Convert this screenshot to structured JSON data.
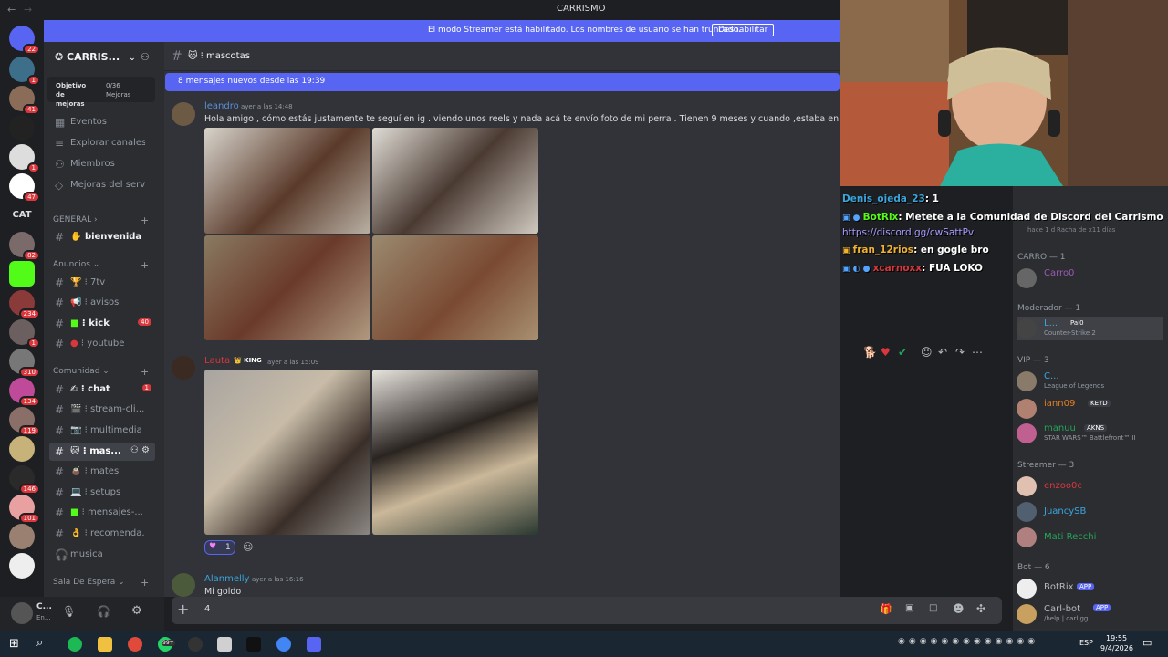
{
  "window": {
    "title": "CARRISMO",
    "back": "←",
    "forward": "→"
  },
  "banner": {
    "text": "El modo Streamer está habilitado. Los nombres de usuario se han truncado.",
    "button": "Deshabilitar"
  },
  "servers": {
    "badges": [
      "22",
      "1",
      "41",
      "1",
      "47",
      "82",
      "234",
      "1",
      "310",
      "134",
      "119",
      "146",
      "101"
    ],
    "cat_label": "CAT"
  },
  "server": {
    "name": "CARRIS...",
    "boost_label": "Objetivo de mejoras",
    "boost_count": "0/36 Mejoras"
  },
  "nav_items": [
    "Eventos",
    "Explorar canales",
    "Miembros",
    "Mejoras del servi..."
  ],
  "categories": {
    "general": "GENERAL",
    "anuncios": "Anuncios",
    "comunidad": "Comunidad",
    "sala": "Sala De Espera"
  },
  "channels": {
    "bienvenida": "bienvenida",
    "seventv": "7tv",
    "avisos": "avisos",
    "kick": "kick",
    "kick_count": "40",
    "youtube": "youtube",
    "chat": "chat",
    "chat_count": "1",
    "stream": "stream-cli...",
    "multimedia": "multimedia",
    "mascotas": "mas...",
    "mates": "mates",
    "setups": "setups",
    "mensajes": "mensajes-...",
    "recomenda": "recomenda...",
    "musica": "musica"
  },
  "user": {
    "name": "C...",
    "status": "En..."
  },
  "channel_header": {
    "name": "mascotas"
  },
  "new_messages": "8 mensajes nuevos desde las 19:39",
  "messages": [
    {
      "author": "leandro",
      "time": "ayer a las 14:48",
      "text": "Hola amigo , cómo estás justamente te seguí en ig . viendo unos reels y nada acá te envío foto de mi perra . Tienen 9 meses y cuando ,estaba en la plaza ten"
    },
    {
      "author": "Lauta",
      "badge": "KING",
      "time": "ayer a las 15:09",
      "reaction_count": "1"
    },
    {
      "author": "Alanmelly",
      "time": "ayer a las 16:16",
      "text": "Mi goldo"
    }
  ],
  "input": {
    "value": "4"
  },
  "stream_chat": [
    {
      "user": "Denis_ojeda_23",
      "text": ": 1"
    },
    {
      "user": "BotRix",
      "text": ": Metete a la Comunidad de Discord del Carrismo"
    },
    {
      "user": "",
      "text": "https://discord.gg/cwSattPv"
    },
    {
      "user": "fran_12rios",
      "text": ": en gogle bro"
    },
    {
      "user": "xcarnoxx",
      "text": ": FUA LOKO"
    }
  ],
  "members": {
    "ghost1": "hace 1 d",
    "ghost2": "Racha de x11 días",
    "carro_header": "CARRO — 1",
    "carro": "Carro0",
    "mod_header": "Moderador — 1",
    "mod": "L...",
    "mod_tag": "Pal0",
    "mod_game": "Counter-Strike 2",
    "vip_header": "VIP — 3",
    "vip1": "C...",
    "vip1_game": "League of Legends",
    "vip2": "iann09",
    "vip2_tag": "KEYD",
    "vip3": "manuu",
    "vip3_tag": "AKNS",
    "vip3_game": "STAR WARS™ Battlefront™ II",
    "streamer_header": "Streamer — 3",
    "s1": "enzoo0c",
    "s2": "JuancySB",
    "s3": "Mati Recchi",
    "bot_header": "Bot — 6",
    "b1": "BotRix",
    "b2": "Carl-bot",
    "app_tag": "APP",
    "b2_status": "/help | carl.gg"
  },
  "taskbar": {
    "time": "19:55",
    "date": "9/4/2026",
    "lang": "ESP",
    "badge": "99+"
  },
  "colors": {
    "blurple": "#5865f2",
    "bg": "#313338",
    "sidebar": "#2b2d31",
    "red": "#da373c",
    "green": "#23a559"
  }
}
